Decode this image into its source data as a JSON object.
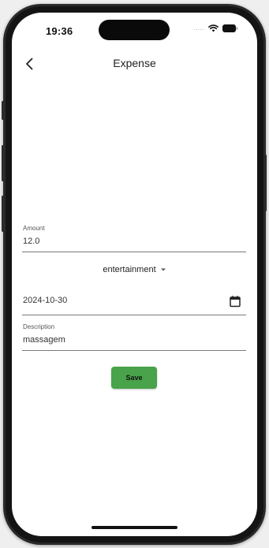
{
  "status_bar": {
    "time": "19:36",
    "signal_dots": "....."
  },
  "app_bar": {
    "title": "Expense"
  },
  "form": {
    "amount": {
      "label": "Amount",
      "value": "12.0"
    },
    "category": {
      "selected": "entertainment"
    },
    "date": {
      "value": "2024-10-30"
    },
    "description": {
      "label": "Description",
      "value": "massagem"
    },
    "save_label": "Save"
  },
  "colors": {
    "accent": "#48a34a",
    "background": "#ffffff",
    "text": "#222222"
  },
  "icons": {
    "back": "chevron-left-icon",
    "calendar": "calendar-icon",
    "dropdown": "caret-down-icon",
    "wifi": "wifi-icon",
    "battery": "battery-icon"
  }
}
